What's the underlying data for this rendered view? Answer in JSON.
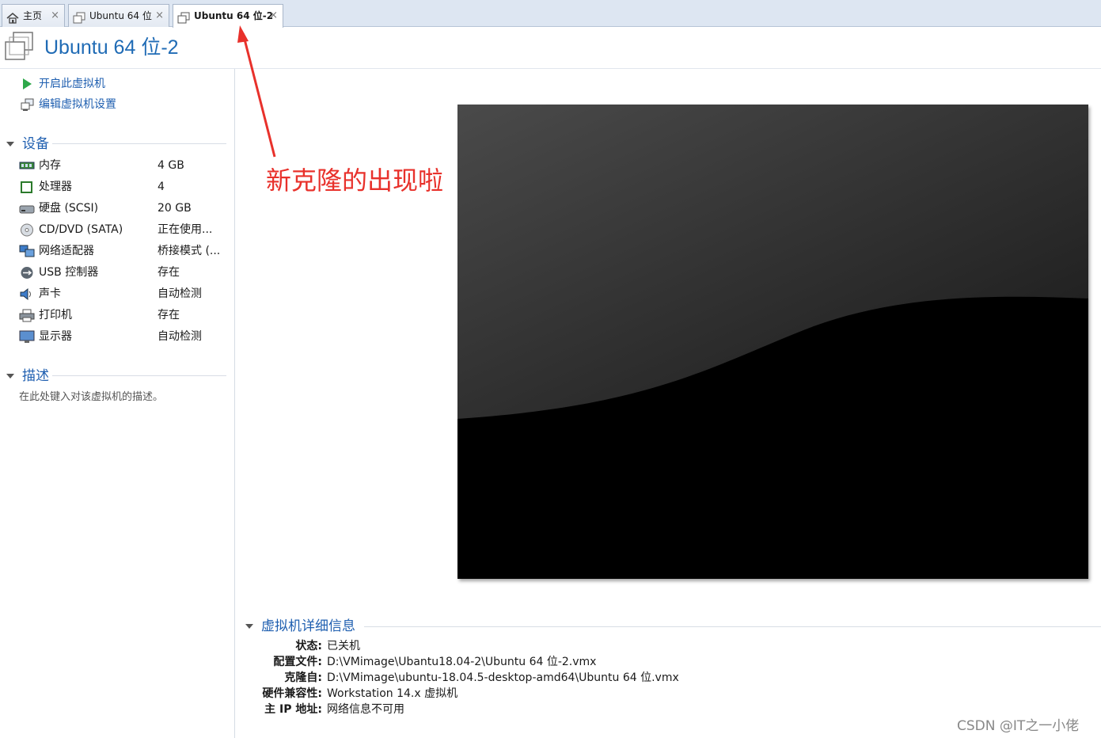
{
  "tabs": [
    {
      "label": "主页",
      "icon": "home-icon"
    },
    {
      "label": "Ubuntu 64 位",
      "icon": "vm-icon"
    },
    {
      "label": "Ubuntu 64 位-2",
      "icon": "vm-icon",
      "active": true
    }
  ],
  "vm": {
    "title": "Ubuntu 64 位-2"
  },
  "actions": {
    "power_on": "开启此虚拟机",
    "edit_settings": "编辑虚拟机设置"
  },
  "devices": {
    "heading": "设备",
    "items": [
      {
        "name": "内存",
        "value": "4 GB",
        "icon": "memory-icon"
      },
      {
        "name": "处理器",
        "value": "4",
        "icon": "cpu-icon"
      },
      {
        "name": "硬盘 (SCSI)",
        "value": "20 GB",
        "icon": "harddisk-icon"
      },
      {
        "name": "CD/DVD (SATA)",
        "value": "正在使用...",
        "icon": "cd-icon"
      },
      {
        "name": "网络适配器",
        "value": "桥接模式 (...",
        "icon": "network-icon"
      },
      {
        "name": "USB 控制器",
        "value": "存在",
        "icon": "usb-icon"
      },
      {
        "name": "声卡",
        "value": "自动检测",
        "icon": "sound-icon"
      },
      {
        "name": "打印机",
        "value": "存在",
        "icon": "printer-icon"
      },
      {
        "name": "显示器",
        "value": "自动检测",
        "icon": "monitor-icon"
      }
    ]
  },
  "description": {
    "heading": "描述",
    "placeholder": "在此处键入对该虚拟机的描述。"
  },
  "annotation": {
    "text": "新克隆的出现啦",
    "color": "#e8312b"
  },
  "details": {
    "heading": "虚拟机详细信息",
    "rows": [
      {
        "key": "状态:",
        "value": "已关机"
      },
      {
        "key": "配置文件:",
        "value": "D:\\VMimage\\Ubantu18.04-2\\Ubuntu 64 位-2.vmx"
      },
      {
        "key": "克隆自:",
        "value": "D:\\VMimage\\ubuntu-18.04.5-desktop-amd64\\Ubuntu 64 位.vmx"
      },
      {
        "key": "硬件兼容性:",
        "value": "Workstation 14.x 虚拟机"
      },
      {
        "key": "主 IP 地址:",
        "value": "网络信息不可用"
      }
    ]
  },
  "watermark": "CSDN @IT之一小佬",
  "colors": {
    "accent": "#1f6bb5",
    "link": "#1f5fb0",
    "annotation": "#e8312b"
  }
}
